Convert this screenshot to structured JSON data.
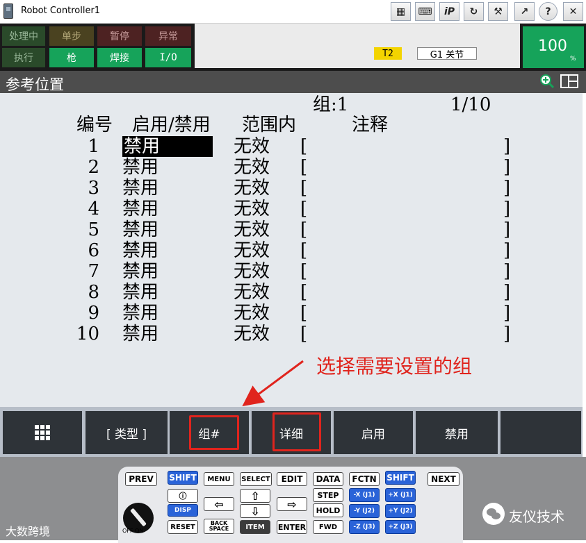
{
  "window": {
    "title": "Robot Controller1",
    "toolbar": [
      {
        "name": "pendant-icon",
        "glyph": "▦"
      },
      {
        "name": "keyboard-icon",
        "glyph": "⌨"
      },
      {
        "name": "ip-icon",
        "glyph": "iP"
      },
      {
        "name": "refresh-icon",
        "glyph": "↻"
      },
      {
        "name": "tools-icon",
        "glyph": "⚒"
      },
      {
        "name": "export-icon",
        "glyph": "↗"
      },
      {
        "name": "help-icon",
        "glyph": "?"
      },
      {
        "name": "close-icon",
        "glyph": "✕"
      }
    ]
  },
  "status": {
    "row1": [
      "处理中",
      "单步",
      "暂停",
      "异常"
    ],
    "row2": [
      "执行",
      "枪",
      "焊接",
      "I/O"
    ],
    "mode": "T2",
    "group_joint": "G1 关节",
    "override_value": "100",
    "override_unit": "%"
  },
  "screen": {
    "title": "参考位置",
    "group_label": "组:1",
    "page": "1/10",
    "headers": [
      "编号",
      "启用/禁用",
      "范围内",
      "注释"
    ],
    "rows": [
      {
        "no": "1",
        "enable": "禁用",
        "range": "无效"
      },
      {
        "no": "2",
        "enable": "禁用",
        "range": "无效"
      },
      {
        "no": "3",
        "enable": "禁用",
        "range": "无效"
      },
      {
        "no": "4",
        "enable": "禁用",
        "range": "无效"
      },
      {
        "no": "5",
        "enable": "禁用",
        "range": "无效"
      },
      {
        "no": "6",
        "enable": "禁用",
        "range": "无效"
      },
      {
        "no": "7",
        "enable": "禁用",
        "range": "无效"
      },
      {
        "no": "8",
        "enable": "禁用",
        "range": "无效"
      },
      {
        "no": "9",
        "enable": "禁用",
        "range": "无效"
      },
      {
        "no": "10",
        "enable": "禁用",
        "range": "无效"
      }
    ],
    "bracket_open": "[",
    "bracket_close": "]"
  },
  "annotation": "选择需要设置的组",
  "softkeys": [
    "[ 类型 ]",
    "组#",
    "详细",
    "启用",
    "禁用"
  ],
  "keypad": {
    "prev": "PREV",
    "shift": "SHIFT",
    "menu": "MENU",
    "select": "SELECT",
    "edit": "EDIT",
    "data": "DATA",
    "fctn": "FCTN",
    "next": "NEXT",
    "disp": "DISP",
    "step": "STEP",
    "hold": "HOLD",
    "reset": "RESET",
    "backspace": "BACK SPACE",
    "item": "ITEM",
    "enter": "ENTER",
    "fwd": "FWD",
    "xneg": "-X (J1)",
    "xpos": "+X (J1)",
    "yneg": "-Y (J2)",
    "ypos": "+Y (J2)",
    "zneg": "-Z (J3)",
    "zpos": "+Z (J3)",
    "off_on": "OFF  ON"
  },
  "watermarks": {
    "left": "大数跨境",
    "right": "友仪技术"
  },
  "colors": {
    "status_green": "#16a35a",
    "annotation_red": "#e0241d",
    "highlight": "#000000",
    "mode_yellow": "#f3d400",
    "key_blue": "#2a63d8"
  }
}
